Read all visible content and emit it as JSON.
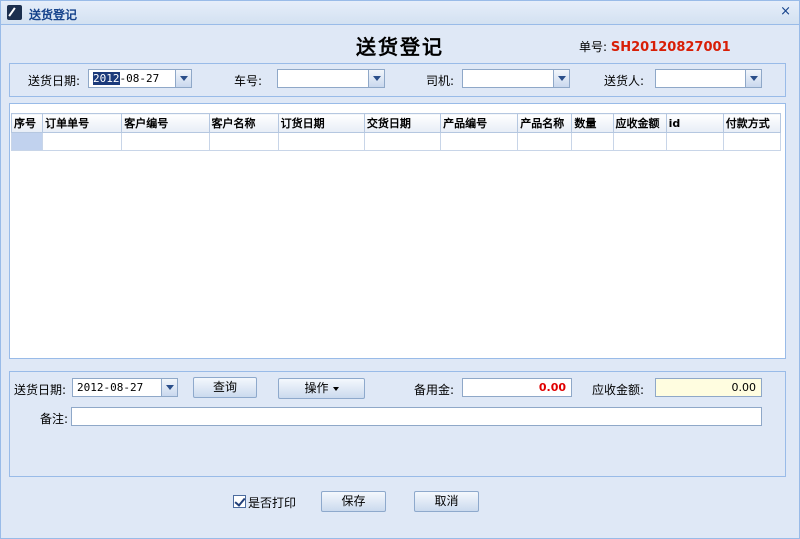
{
  "window": {
    "title": "送货登记",
    "close_label": "×"
  },
  "header": {
    "title": "送货登记",
    "order_no_label": "单号:",
    "order_no_value": "SH20120827001"
  },
  "filters": {
    "date_label": "送货日期:",
    "date_value_selected": "2012",
    "date_value_rest": "-08-27",
    "car_label": "车号:",
    "car_value": "",
    "driver_label": "司机:",
    "driver_value": "",
    "courier_label": "送货人:",
    "courier_value": ""
  },
  "grid": {
    "columns": [
      "序号",
      "订单单号",
      "客户编号",
      "客户名称",
      "订货日期",
      "交货日期",
      "产品编号",
      "产品名称",
      "数量",
      "应收金额",
      "id",
      "付款方式"
    ],
    "rows": [
      [
        "",
        "",
        "",
        "",
        "",
        "",
        "",
        "",
        "",
        "",
        "",
        ""
      ]
    ]
  },
  "bottom": {
    "date_label": "送货日期:",
    "date_value": "2012-08-27",
    "query_button": "查询",
    "operate_button": "操作",
    "reserve_label": "备用金:",
    "reserve_value": "0.00",
    "receivable_label": "应收金额:",
    "receivable_value": "0.00",
    "remark_label": "备注:",
    "remark_value": ""
  },
  "footer": {
    "print_label": "是否打印",
    "print_checked": true,
    "save_button": "保存",
    "cancel_button": "取消"
  },
  "colors": {
    "accent": "#15428b",
    "order_no": "#d81e06",
    "reserve_amount": "#e00000",
    "panel": "#dfe8f6"
  }
}
